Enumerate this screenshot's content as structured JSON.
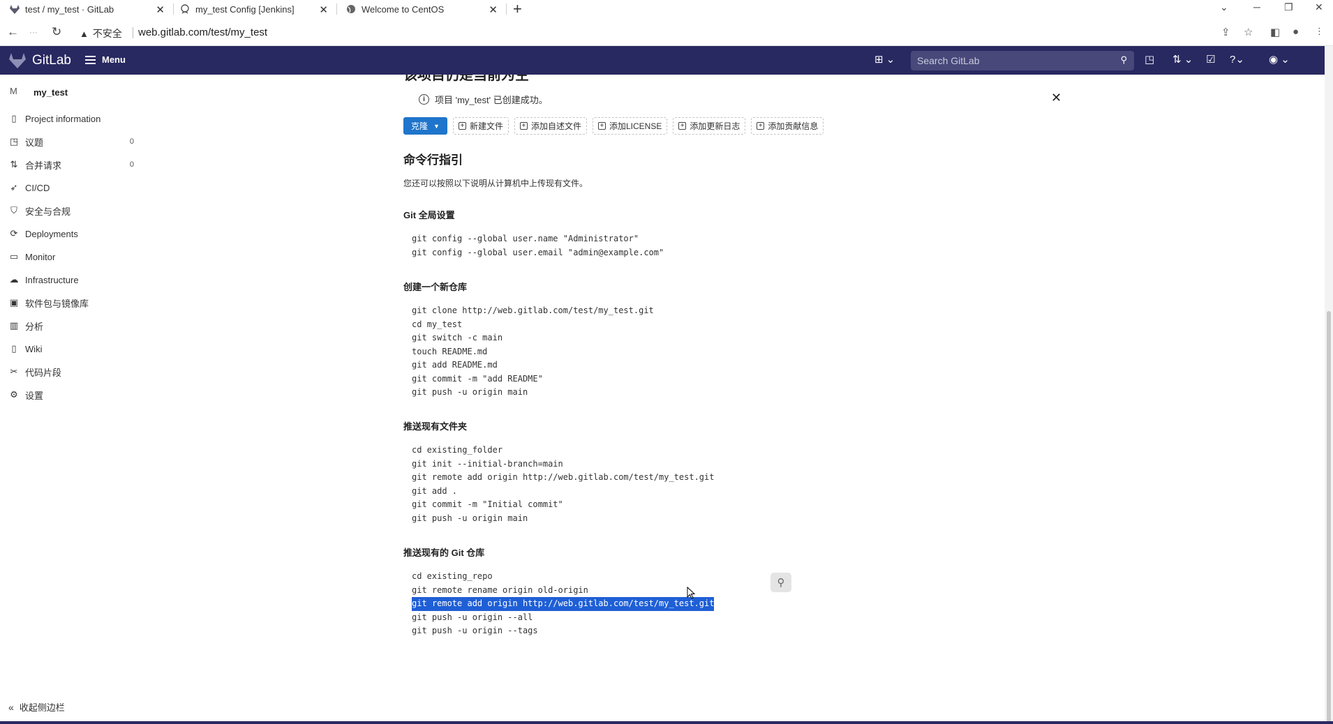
{
  "browser": {
    "tabs": [
      {
        "title": "test / my_test · GitLab",
        "icon": "gitlab-fox-icon"
      },
      {
        "title": "my_test Config [Jenkins]",
        "icon": "jenkins-icon"
      },
      {
        "title": "Welcome to CentOS",
        "icon": "globe-icon"
      }
    ],
    "security_label": "不安全",
    "url": "web.gitlab.com/test/my_test"
  },
  "gitlab_nav": {
    "brand": "GitLab",
    "menu_label": "Menu",
    "search_placeholder": "Search GitLab"
  },
  "sidebar": {
    "project_initial": "M",
    "project_name": "my_test",
    "items": [
      {
        "label": "Project information",
        "icon": "book-icon",
        "count": ""
      },
      {
        "label": "议题",
        "icon": "issues-icon",
        "count": "0"
      },
      {
        "label": "合并请求",
        "icon": "merge-request-icon",
        "count": "0"
      },
      {
        "label": "CI/CD",
        "icon": "rocket-icon",
        "count": ""
      },
      {
        "label": "安全与合规",
        "icon": "shield-icon",
        "count": ""
      },
      {
        "label": "Deployments",
        "icon": "deployments-icon",
        "count": ""
      },
      {
        "label": "Monitor",
        "icon": "monitor-icon",
        "count": ""
      },
      {
        "label": "Infrastructure",
        "icon": "cloud-icon",
        "count": ""
      },
      {
        "label": "软件包与镜像库",
        "icon": "package-icon",
        "count": ""
      },
      {
        "label": "分析",
        "icon": "chart-icon",
        "count": ""
      },
      {
        "label": "Wiki",
        "icon": "wiki-icon",
        "count": ""
      },
      {
        "label": "代码片段",
        "icon": "snippet-icon",
        "count": ""
      },
      {
        "label": "设置",
        "icon": "gear-icon",
        "count": ""
      }
    ],
    "collapse_label": "收起侧边栏"
  },
  "main": {
    "truncated_title": "该项目仍是当前为空",
    "alert_text": "项目 'my_test' 已创建成功。",
    "clone_label": "克隆",
    "actions": [
      "新建文件",
      "添加自述文件",
      "添加LICENSE",
      "添加更新日志",
      "添加贡献信息"
    ],
    "cli_title": "命令行指引",
    "cli_desc": "您还可以按照以下说明从计算机中上传现有文件。",
    "sections": [
      {
        "heading": "Git 全局设置",
        "lines": [
          "git config --global user.name \"Administrator\"",
          "git config --global user.email \"admin@example.com\""
        ]
      },
      {
        "heading": "创建一个新仓库",
        "lines": [
          "git clone http://web.gitlab.com/test/my_test.git",
          "cd my_test",
          "git switch -c main",
          "touch README.md",
          "git add README.md",
          "git commit -m \"add README\"",
          "git push -u origin main"
        ]
      },
      {
        "heading": "推送现有文件夹",
        "lines": [
          "cd existing_folder",
          "git init --initial-branch=main",
          "git remote add origin http://web.gitlab.com/test/my_test.git",
          "git add .",
          "git commit -m \"Initial commit\"",
          "git push -u origin main"
        ]
      },
      {
        "heading": "推送现有的 Git 仓库",
        "lines": [
          "cd existing_repo",
          "git remote rename origin old-origin",
          "git remote add origin http://web.gitlab.com/test/my_test.git",
          "git push -u origin --all",
          "git push -u origin --tags"
        ],
        "selected_line": 2
      }
    ]
  },
  "colors": {
    "nav_bg": "#292961",
    "primary": "#1f75cb",
    "selection": "#1f5fd6"
  }
}
